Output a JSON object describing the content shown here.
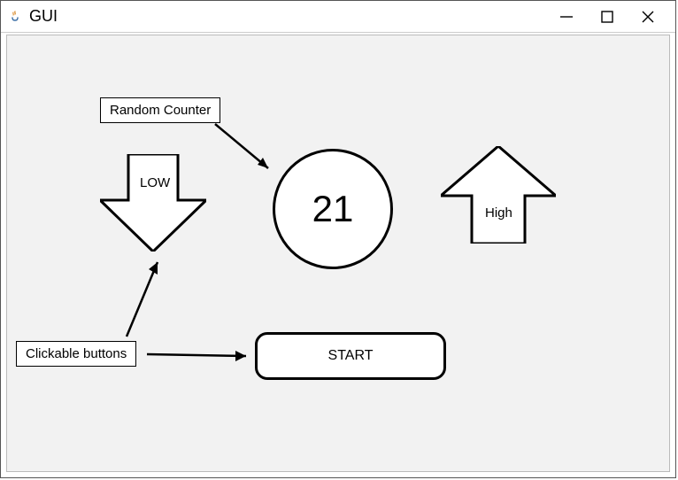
{
  "window": {
    "title": "GUI"
  },
  "annotations": {
    "random_counter": "Random Counter",
    "clickable_buttons": "Clickable buttons"
  },
  "buttons": {
    "low": "LOW",
    "high": "High",
    "start": "START"
  },
  "counter": {
    "value": "21"
  }
}
